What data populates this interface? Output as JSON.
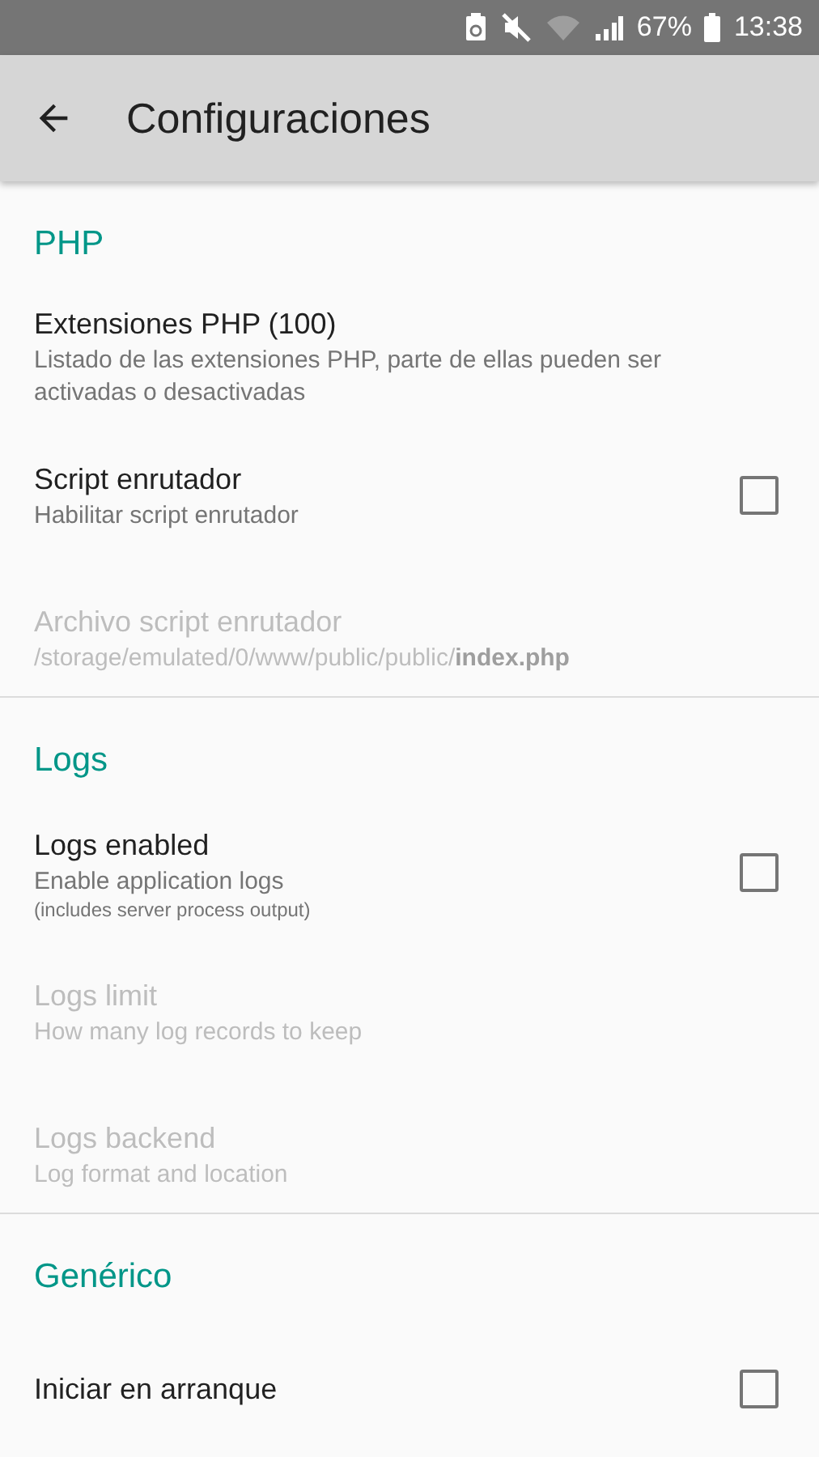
{
  "status_bar": {
    "battery": "67%",
    "time": "13:38"
  },
  "toolbar": {
    "title": "Configuraciones"
  },
  "sections": [
    {
      "title": "PHP",
      "items": [
        {
          "kind": "text",
          "title": "Extensiones PHP (100)",
          "summary": "Listado de las extensiones PHP, parte de ellas pueden ser activadas o desactivadas",
          "disabled": false
        },
        {
          "kind": "checkbox",
          "title": "Script enrutador",
          "summary": "Habilitar script enrutador",
          "disabled": false,
          "checked": false
        },
        {
          "kind": "text",
          "title": "Archivo script enrutador",
          "summary": "/storage/emulated/0/www/public/public/**index.php**",
          "disabled": true
        }
      ]
    },
    {
      "title": "Logs",
      "items": [
        {
          "kind": "checkbox",
          "title": "Logs enabled",
          "summary": "Enable application logs",
          "note": "(includes server process output)",
          "disabled": false,
          "checked": false
        },
        {
          "kind": "text",
          "title": "Logs limit",
          "summary": "How many log records to keep",
          "disabled": true
        },
        {
          "kind": "text",
          "title": "Logs backend",
          "summary": "Log format and location",
          "disabled": true
        }
      ]
    },
    {
      "title": "Genérico",
      "items": [
        {
          "kind": "checkbox",
          "title": "Iniciar en arranque",
          "disabled": false,
          "checked": false
        }
      ]
    }
  ]
}
